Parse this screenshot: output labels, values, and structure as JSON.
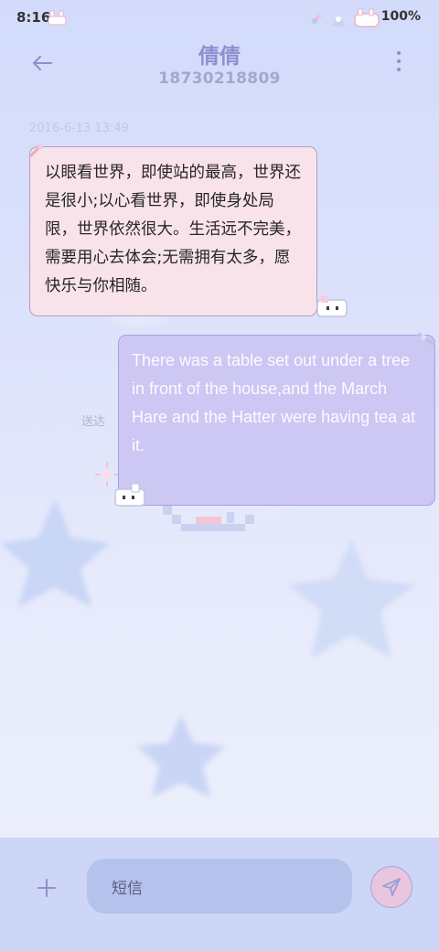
{
  "status_bar": {
    "time": "8:16",
    "battery": "100%"
  },
  "header": {
    "contact_name": "倩倩",
    "phone_number": "18730218809"
  },
  "conversation": {
    "timestamp": "2016-6-13 13:49",
    "messages": [
      {
        "direction": "incoming",
        "text": "以眼看世界，即使站的最高，世界还是很小;以心看世界，即使身处局限，世界依然很大。生活远不完美，需要用心去体会;无需拥有太多，愿快乐与你相随。"
      },
      {
        "direction": "outgoing",
        "text": "There was a table set out under a tree in front of the house,and the March Hare and the Hatter were having tea at it.",
        "status": "送达"
      }
    ]
  },
  "composer": {
    "placeholder": "短信"
  },
  "icons": {
    "back": "arrow-left-icon",
    "more": "more-vertical-icon",
    "attach": "plus-icon",
    "send": "send-icon"
  },
  "colors": {
    "accent": "#8c8fd0",
    "incoming_bubble": "#f9e3ea",
    "outgoing_bubble": "#cdc7f4",
    "composer_bar": "#cdd6f6"
  }
}
